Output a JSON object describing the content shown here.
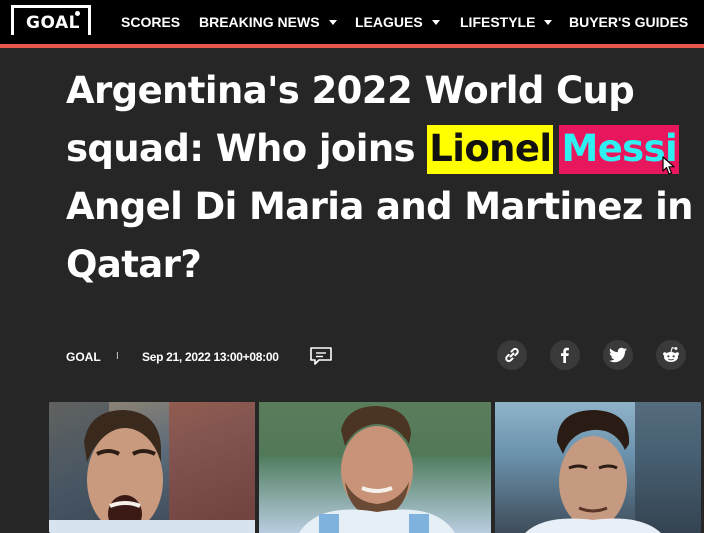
{
  "site": {
    "logo_text": "GOAL",
    "accent_color": "#e8574a"
  },
  "nav": {
    "items": [
      {
        "label": "SCORES",
        "has_dropdown": false
      },
      {
        "label": "BREAKING NEWS",
        "has_dropdown": true
      },
      {
        "label": "LEAGUES",
        "has_dropdown": true
      },
      {
        "label": "LIFESTYLE",
        "has_dropdown": true
      },
      {
        "label": "BUYER'S GUIDES",
        "has_dropdown": false
      }
    ]
  },
  "article": {
    "title_part1": "Argentina's 2022 World Cup squad: Who joins ",
    "title_highlight1": "Lionel",
    "title_highlight2": "Messi",
    "title_part2": " Angel Di Maria and Martinez in Qatar?",
    "author": "GOAL",
    "separator": "I",
    "date": "Sep 21, 2022 13:00+08:00"
  },
  "highlight_colors": {
    "yellow": "#ffff00",
    "pink": "#e8175d",
    "cyan_text": "#2ef0f0"
  },
  "share": {
    "icons": [
      "link-icon",
      "facebook-icon",
      "twitter-icon",
      "reddit-icon"
    ]
  }
}
